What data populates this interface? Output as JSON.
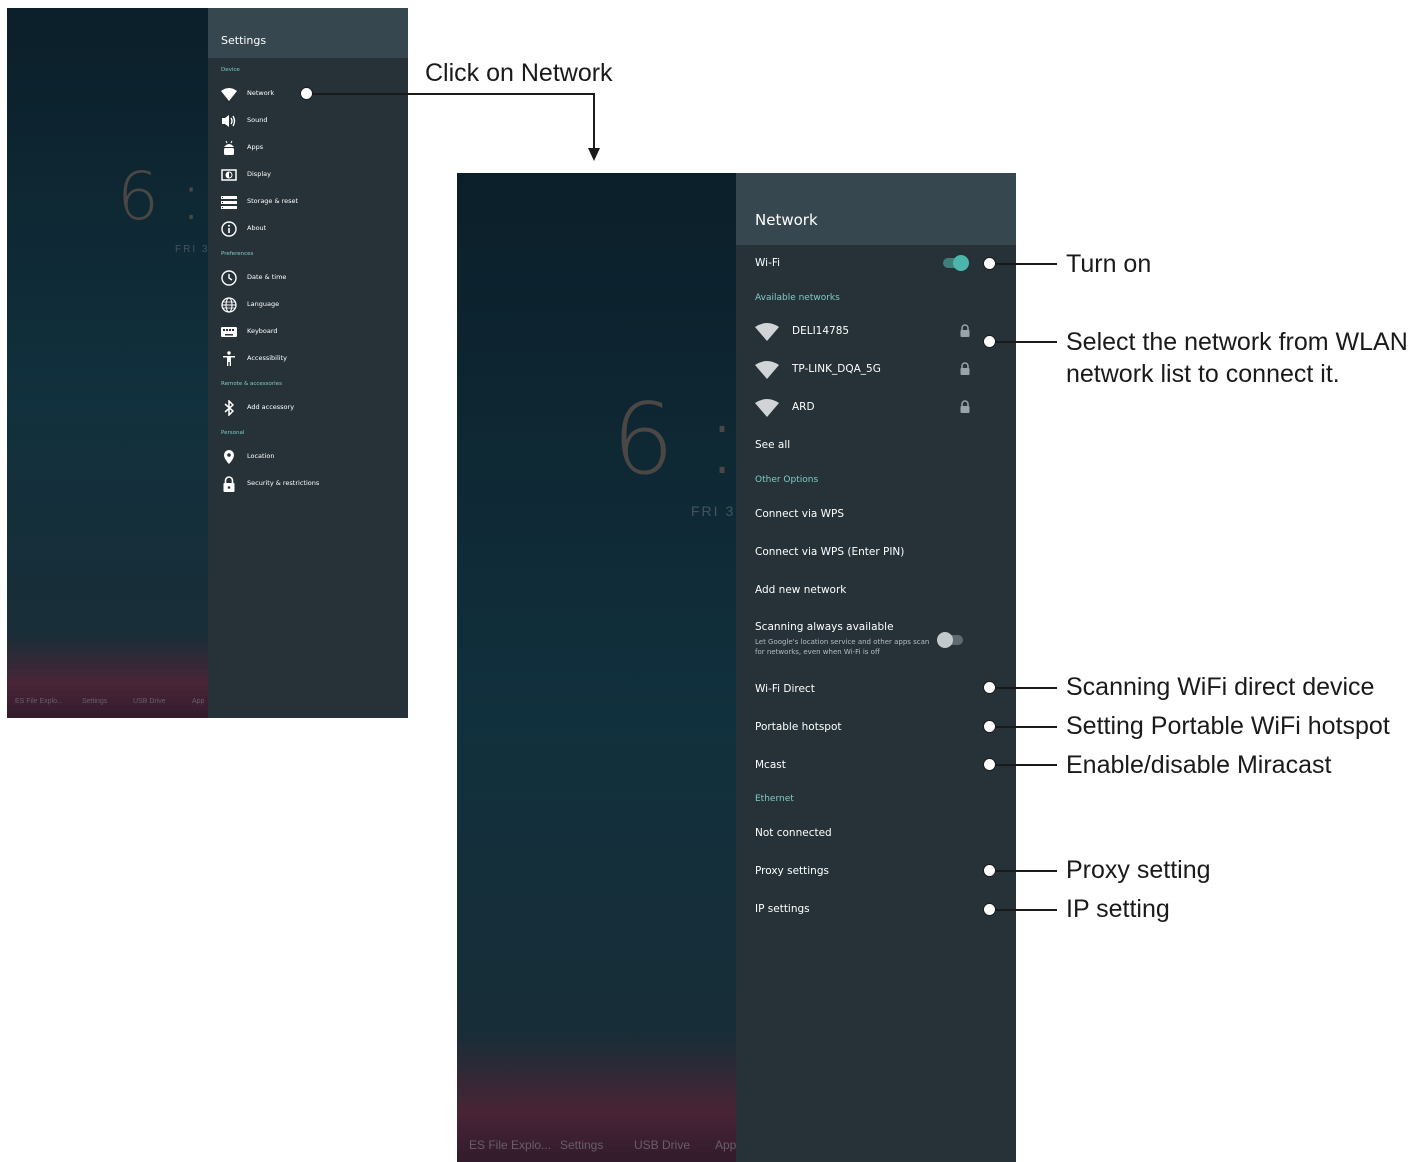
{
  "screen1": {
    "clock": "6 :",
    "date": "FRI 3",
    "dock_labels": [
      "ES File Explo...",
      "Settings",
      "USB Drive",
      "App"
    ],
    "panel_title": "Settings",
    "sections": [
      {
        "header": "Device",
        "items": [
          {
            "label": "Network",
            "icon": "wifi-icon"
          },
          {
            "label": "Sound",
            "icon": "speaker-icon"
          },
          {
            "label": "Apps",
            "icon": "android-icon"
          },
          {
            "label": "Display",
            "icon": "display-icon"
          },
          {
            "label": "Storage & reset",
            "icon": "storage-icon"
          },
          {
            "label": "About",
            "icon": "info-icon"
          }
        ]
      },
      {
        "header": "Preferences",
        "items": [
          {
            "label": "Date & time",
            "icon": "clock-icon"
          },
          {
            "label": "Language",
            "icon": "globe-icon"
          },
          {
            "label": "Keyboard",
            "icon": "keyboard-icon"
          },
          {
            "label": "Accessibility",
            "icon": "accessibility-icon"
          }
        ]
      },
      {
        "header": "Remote & accessories",
        "items": [
          {
            "label": "Add accessory",
            "icon": "bluetooth-icon"
          }
        ]
      },
      {
        "header": "Personal",
        "items": [
          {
            "label": "Location",
            "icon": "location-pin-icon"
          },
          {
            "label": "Security & restrictions",
            "icon": "lock-icon"
          }
        ]
      }
    ]
  },
  "screen2": {
    "clock": "6 :",
    "date": "FRI 3",
    "dock_labels": [
      "ES File Explo...",
      "Settings",
      "USB Drive",
      "App"
    ],
    "panel_title": "Network",
    "wifi": {
      "label": "Wi-Fi",
      "enabled": true
    },
    "available_header": "Available networks",
    "networks": [
      {
        "ssid": "DELI14785",
        "secured": true
      },
      {
        "ssid": "TP-LINK_DQA_5G",
        "secured": true
      },
      {
        "ssid": "ARD",
        "secured": true
      }
    ],
    "see_all": "See all",
    "other_header": "Other Options",
    "connect_wps": "Connect via WPS",
    "connect_wps_pin": "Connect via WPS (Enter PIN)",
    "add_network": "Add new network",
    "scanning": {
      "title": "Scanning always available",
      "desc_line1": "Let Google's location service and other apps scan",
      "desc_line2": "for networks, even when Wi-Fi is off",
      "enabled": false
    },
    "wifi_direct": "Wi-Fi Direct",
    "hotspot": "Portable hotspot",
    "mcast": "Mcast",
    "ethernet_header": "Ethernet",
    "not_connected": "Not connected",
    "proxy": "Proxy settings",
    "ip": "IP settings"
  },
  "annotations": {
    "click_network": "Click on Network",
    "turn_on": "Turn on",
    "select_network_line1": "Select the network from WLAN",
    "select_network_line2": "network list to connect it.",
    "wifi_direct": "Scanning WiFi direct device",
    "hotspot": "Setting Portable WiFi hotspot",
    "miracast": "Enable/disable Miracast",
    "proxy": "Proxy setting",
    "ip": "IP setting"
  },
  "colors": {
    "panel": "#263238",
    "panel_header": "#37474f",
    "accent": "#80cbc4",
    "toggle_on": "#4db6ac"
  }
}
